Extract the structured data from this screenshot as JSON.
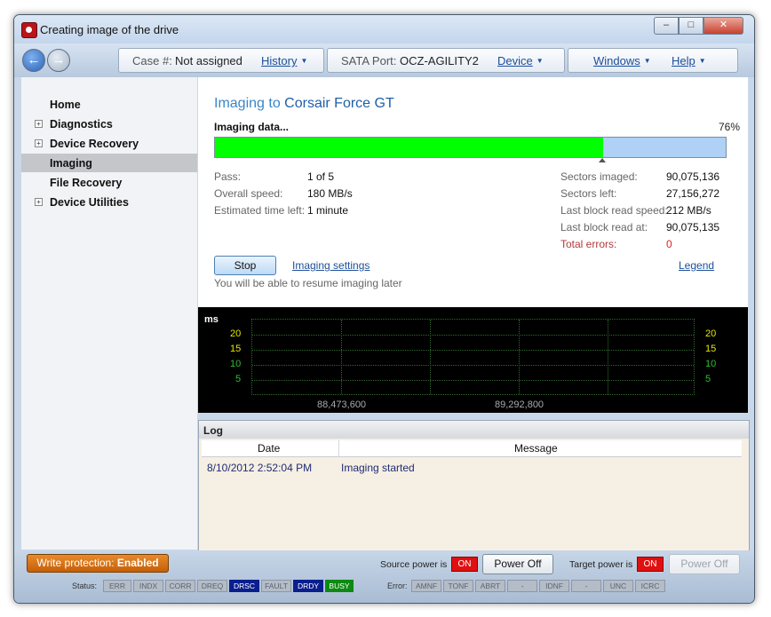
{
  "window": {
    "title": "Creating image of the drive",
    "controls": {
      "minimize": "–",
      "maximize": "□",
      "close": "✕"
    }
  },
  "toolbar": {
    "case_label": "Case #:",
    "case_value": "Not assigned",
    "history": "History",
    "sata_label": "SATA Port:",
    "sata_value": "OCZ-AGILITY2",
    "device": "Device",
    "windows": "Windows",
    "help": "Help"
  },
  "sidebar": {
    "items": [
      {
        "label": "Home",
        "expandable": false
      },
      {
        "label": "Diagnostics",
        "expandable": true
      },
      {
        "label": "Device Recovery",
        "expandable": true
      },
      {
        "label": "Imaging",
        "expandable": false,
        "active": true
      },
      {
        "label": "File Recovery",
        "expandable": false
      },
      {
        "label": "Device Utilities",
        "expandable": true
      }
    ]
  },
  "main": {
    "heading_prefix": "Imaging to",
    "heading_device": "Corsair Force GT",
    "status": "Imaging data...",
    "progress_percent_text": "76%",
    "progress_fraction": 0.76,
    "left_stats": [
      {
        "label": "Pass:",
        "value": "1 of 5"
      },
      {
        "label": "Overall speed:",
        "value": "180 MB/s"
      },
      {
        "label": "Estimated time left:",
        "value": "1 minute"
      }
    ],
    "right_stats": [
      {
        "label": "Sectors imaged:",
        "value": "90,075,136"
      },
      {
        "label": "Sectors left:",
        "value": "27,156,272"
      },
      {
        "label": "Last block read speed:",
        "value": "212 MB/s"
      },
      {
        "label": "Last block read at:",
        "value": "90,075,135"
      },
      {
        "label": "Total errors:",
        "value": "0",
        "highlight": true
      }
    ],
    "stop_button": "Stop",
    "imaging_settings_link": "Imaging settings",
    "legend_link": "Legend",
    "resume_hint": "You will be able to resume imaging later"
  },
  "graph": {
    "unit": "ms",
    "y_ticks": [
      "20",
      "15",
      "10",
      "5"
    ],
    "y_tick_colors": [
      "#e6e600",
      "#e6e600",
      "#2fbf2f",
      "#2fbf2f"
    ],
    "x_ticks": [
      "88,473,600",
      "89,292,800"
    ]
  },
  "log": {
    "title": "Log",
    "columns": [
      "Date",
      "Message"
    ],
    "rows": [
      {
        "date": "8/10/2012 2:52:04 PM",
        "message": "Imaging started"
      }
    ]
  },
  "footer": {
    "write_protection_label": "Write protection:",
    "write_protection_value": "Enabled",
    "source_power_label": "Source power is",
    "source_power_state": "ON",
    "source_power_button": "Power Off",
    "target_power_label": "Target power is",
    "target_power_state": "ON",
    "target_power_button": "Power Off",
    "status_label": "Status:",
    "status_registers": [
      {
        "name": "ERR",
        "active": false
      },
      {
        "name": "INDX",
        "active": false
      },
      {
        "name": "CORR",
        "active": false
      },
      {
        "name": "DREQ",
        "active": false
      },
      {
        "name": "DRSC",
        "active": true,
        "color": "#0a1e8e"
      },
      {
        "name": "FAULT",
        "active": false
      },
      {
        "name": "DRDY",
        "active": true,
        "color": "#0a1e8e"
      },
      {
        "name": "BUSY",
        "active": true,
        "color": "#0c8a12"
      }
    ],
    "error_label": "Error:",
    "error_registers": [
      "AMNF",
      "TONF",
      "ABRT",
      "-",
      "IDNF",
      "-",
      "UNC",
      "ICRC"
    ]
  },
  "colors": {
    "accent": "#3a86c8",
    "progress_fill": "#00ff00",
    "progress_track": "#aed1f5",
    "error_red": "#e02020"
  }
}
